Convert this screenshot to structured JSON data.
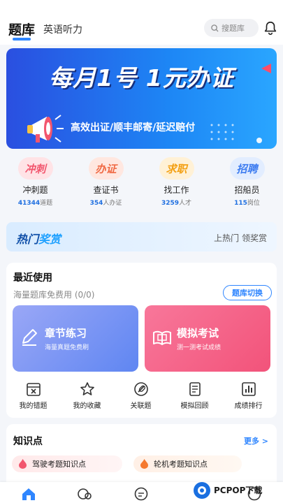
{
  "header": {
    "tab_active": "题库",
    "tab_other": "英语听力",
    "search_placeholder": "搜题库"
  },
  "banner": {
    "title": "每月1号  1元办证",
    "subtitle": "高效出证/顺丰邮寄/延迟赔付"
  },
  "categories": [
    {
      "badge": "冲刺",
      "label": "冲刺题",
      "count": "41344",
      "unit": "道题",
      "color": "#ffe3e6",
      "text_color": "#f2566e"
    },
    {
      "badge": "办证",
      "label": "查证书",
      "count": "354",
      "unit": "人办证",
      "color": "#ffe7e0",
      "text_color": "#f06a45"
    },
    {
      "badge": "求职",
      "label": "找工作",
      "count": "3259",
      "unit": "人才",
      "color": "#fff1d6",
      "text_color": "#f3a013"
    },
    {
      "badge": "招聘",
      "label": "招船员",
      "count": "115",
      "unit": "岗位",
      "color": "#e2edff",
      "text_color": "#3d7cf0"
    }
  ],
  "hot": {
    "title_a": "热门",
    "title_b": "奖赏",
    "right": "上热门 领奖赏"
  },
  "recent": {
    "title": "最近使用",
    "sub": "海量题库免费用 (0/0)",
    "switch_label": "题库切换",
    "practice_title": "章节练习",
    "practice_sub": "海量真题免费刷",
    "exam_title": "模拟考试",
    "exam_sub": "测一测考试成绩",
    "tools": [
      {
        "label": "我的错题",
        "icon": "wrong-questions-icon"
      },
      {
        "label": "我的收藏",
        "icon": "star-icon"
      },
      {
        "label": "关联题",
        "icon": "link-icon"
      },
      {
        "label": "模拟回顾",
        "icon": "review-icon"
      },
      {
        "label": "成绩排行",
        "icon": "ranking-icon"
      }
    ]
  },
  "knowledge": {
    "title": "知识点",
    "more": "更多 >",
    "items": [
      "驾驶考题知识点",
      "轮机考题知识点"
    ]
  },
  "watermark": "PCPOP下载",
  "colors": {
    "accent": "#2f86ff",
    "banner": "#1d86f5"
  }
}
